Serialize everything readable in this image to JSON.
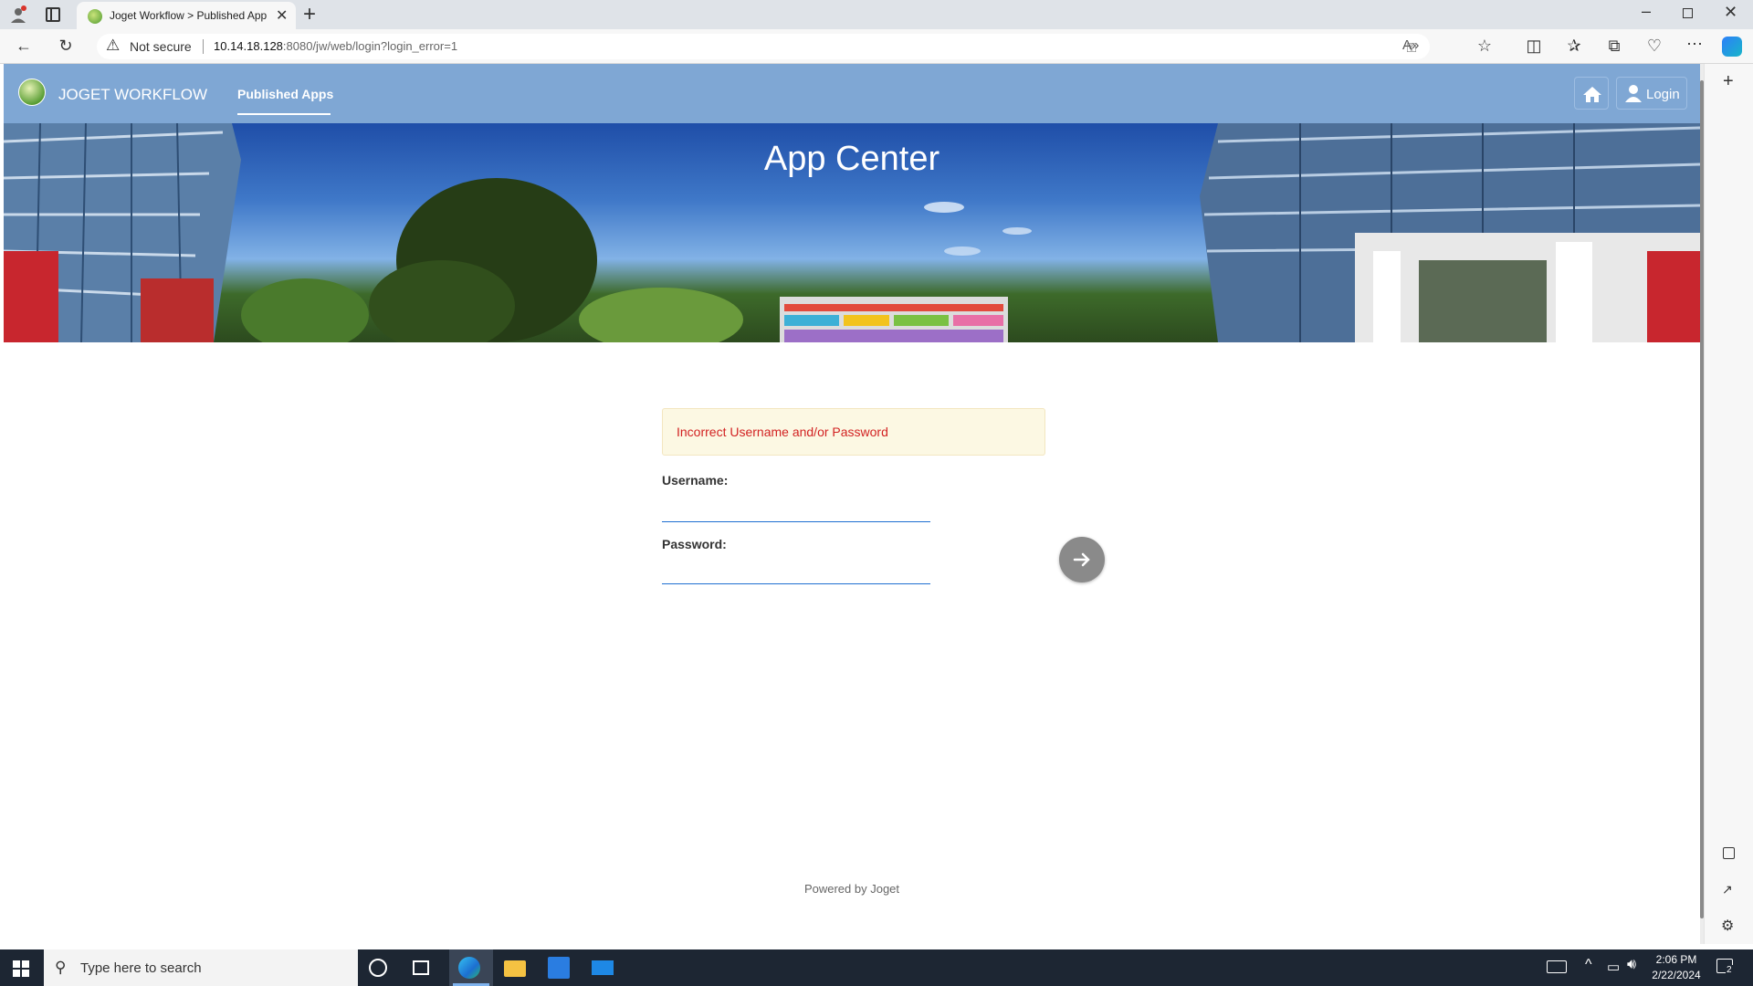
{
  "browser": {
    "tab_title": "Joget Workflow > Published App",
    "security_label": "Not secure",
    "url_host": "10.14.18.128",
    "url_rest": ":8080/jw/web/login?login_error=1"
  },
  "app": {
    "brand": "JOGET WORKFLOW",
    "nav_published_apps": "Published Apps",
    "login_label": "Login",
    "hero_title": "App Center",
    "error_message": "Incorrect Username and/or Password",
    "username_label": "Username:",
    "password_label": "Password:",
    "username_value": "",
    "password_value": "",
    "footer": "Powered by Joget"
  },
  "taskbar": {
    "search_placeholder": "Type here to search",
    "time": "2:06 PM",
    "date": "2/22/2024",
    "notification_count": "2"
  },
  "colors": {
    "navbar": "#7fa7d4",
    "error_text": "#d22222",
    "error_bg": "#fcf8e3",
    "accent": "#1f6fd1",
    "submit_button": "#8a8a8a"
  },
  "icons": [
    "profile-icon",
    "tab-actions-icon",
    "close-icon",
    "new-tab-icon",
    "back-icon",
    "refresh-icon",
    "warning-icon",
    "read-aloud-icon",
    "favorite-icon",
    "split-screen-icon",
    "favorites-icon",
    "collections-icon",
    "browser-essentials-icon",
    "more-icon",
    "copilot-icon",
    "home-icon",
    "user-icon",
    "arrow-right-icon",
    "windows-start-icon",
    "search-icon",
    "cortana-icon",
    "task-view-icon",
    "edge-icon",
    "file-explorer-icon",
    "store-icon",
    "mail-icon"
  ]
}
